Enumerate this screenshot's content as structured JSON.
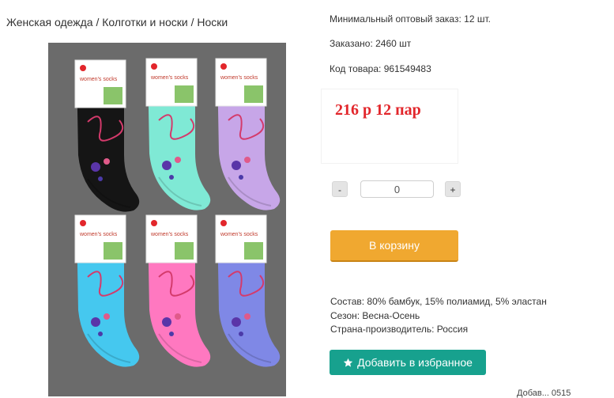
{
  "breadcrumb": "Женская одежда / Колготки и носки / Носки",
  "product": {
    "min_order": "Минимальный оптовый заказ: 12 шт.",
    "ordered": "Заказано: 2460 шт",
    "code": "Код товара: 961549483",
    "price": "216 р 12 пар",
    "tag_text": "women's socks"
  },
  "quantity": {
    "minus_label": "-",
    "value": "0",
    "plus_label": "+"
  },
  "cart_button": "В корзину",
  "properties": [
    "Состав: 80% бамбук, 15% полиамид, 5% эластан",
    "Сезон: Весна-Осень",
    "Страна-производитель: Россия"
  ],
  "favorite_button": "Добавить в избранное",
  "footer_fragment": "Добав... 0515",
  "colors": {
    "price": "#e2262b",
    "cart_button": "#f0a830",
    "favorite_button": "#17a18e",
    "photo_background": "#6b6b6b",
    "sock_colors": [
      "#151515",
      "#7fe9d5",
      "#c7a6e8",
      "#45c8ef",
      "#ff78c0",
      "#7f88e6"
    ]
  }
}
